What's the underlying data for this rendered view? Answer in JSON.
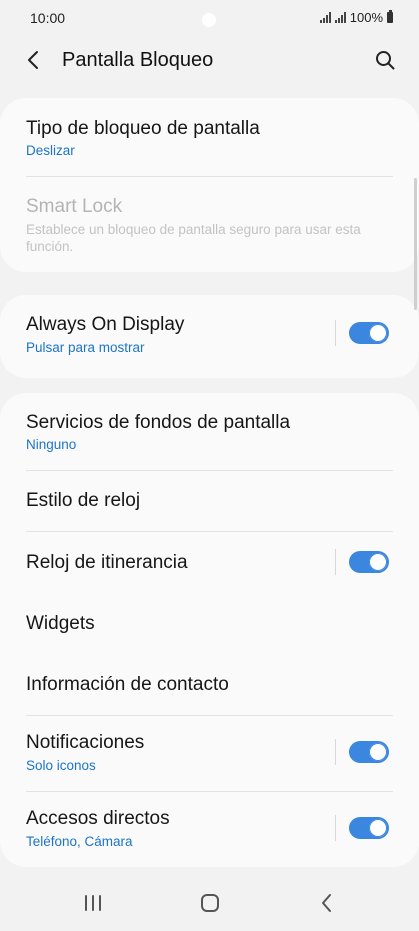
{
  "status_bar": {
    "time": "10:00",
    "battery": "100%"
  },
  "app_bar": {
    "title": "Pantalla Bloqueo"
  },
  "card1": {
    "items": [
      {
        "title": "Tipo de bloqueo de pantalla",
        "subtitle": "Deslizar"
      },
      {
        "title": "Smart Lock",
        "subtitle": "Establece un bloqueo de pantalla seguro para usar esta función.",
        "disabled": true
      }
    ]
  },
  "card2": {
    "items": [
      {
        "title": "Always On Display",
        "subtitle": "Pulsar para mostrar",
        "toggle": true
      }
    ]
  },
  "card3": {
    "items": [
      {
        "title": "Servicios de fondos de pantalla",
        "subtitle": "Ninguno"
      },
      {
        "title": "Estilo de reloj"
      },
      {
        "title": "Reloj de itinerancia",
        "toggle": true
      },
      {
        "title": "Widgets"
      },
      {
        "title": "Información de contacto"
      },
      {
        "title": "Notificaciones",
        "subtitle": "Solo iconos",
        "toggle": true
      },
      {
        "title": "Accesos directos",
        "subtitle": "Teléfono, Cámara",
        "toggle": true
      }
    ]
  },
  "colors": {
    "accent": "#3b86de",
    "link": "#1c74c9",
    "background": "#f2f2f2",
    "card": "#fafafa"
  },
  "icons": [
    "back-arrow-icon",
    "search-icon",
    "recent-apps-icon",
    "home-icon",
    "nav-back-icon"
  ]
}
